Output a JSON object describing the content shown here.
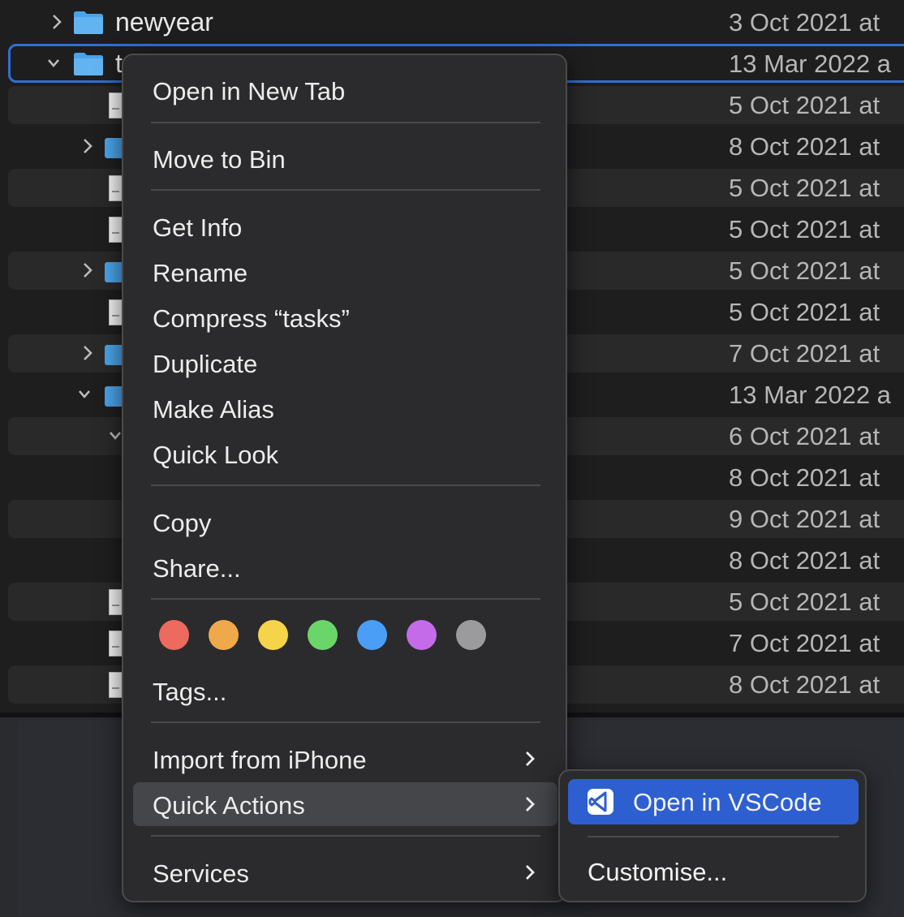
{
  "finder": {
    "rows": [
      {
        "name": "newyear",
        "date": "3 Oct 2021 at"
      },
      {
        "name": "t",
        "date": "13 Mar 2022 a"
      },
      {
        "name": "",
        "date": "5 Oct 2021 at"
      },
      {
        "name": "",
        "date": "8 Oct 2021 at"
      },
      {
        "name": "",
        "date": "5 Oct 2021 at"
      },
      {
        "name": "",
        "date": "5 Oct 2021 at"
      },
      {
        "name": "",
        "date": "5 Oct 2021 at"
      },
      {
        "name": "",
        "date": "5 Oct 2021 at"
      },
      {
        "name": "",
        "date": "7 Oct 2021 at"
      },
      {
        "name": "",
        "date": "13 Mar 2022 a"
      },
      {
        "name": "",
        "date": "6 Oct 2021 at"
      },
      {
        "name": "",
        "date": "8 Oct 2021 at"
      },
      {
        "name": "",
        "date": "9 Oct 2021 at"
      },
      {
        "name": "",
        "date": "8 Oct 2021 at"
      },
      {
        "name": "",
        "date": "5 Oct 2021 at"
      },
      {
        "name": "",
        "date": "7 Oct 2021 at"
      },
      {
        "name": "",
        "date": "8 Oct 2021 at"
      }
    ]
  },
  "menu": {
    "open_in_new_tab": "Open in New Tab",
    "move_to_bin": "Move to Bin",
    "get_info": "Get Info",
    "rename": "Rename",
    "compress": "Compress “tasks”",
    "duplicate": "Duplicate",
    "make_alias": "Make Alias",
    "quick_look": "Quick Look",
    "copy": "Copy",
    "share": "Share...",
    "tags_label": "Tags...",
    "import_from_iphone": "Import from iPhone",
    "quick_actions": "Quick Actions",
    "services": "Services",
    "tag_colors": [
      "#ec6a5e",
      "#f0a94a",
      "#f6d44a",
      "#6ad66a",
      "#4a9ef5",
      "#c46bea",
      "#9b9b9e"
    ]
  },
  "submenu": {
    "open_in_vscode": "Open in VSCode",
    "customise": "Customise..."
  },
  "colors": {
    "accent": "#2d5fd0",
    "folder": "#4aa3e8"
  }
}
